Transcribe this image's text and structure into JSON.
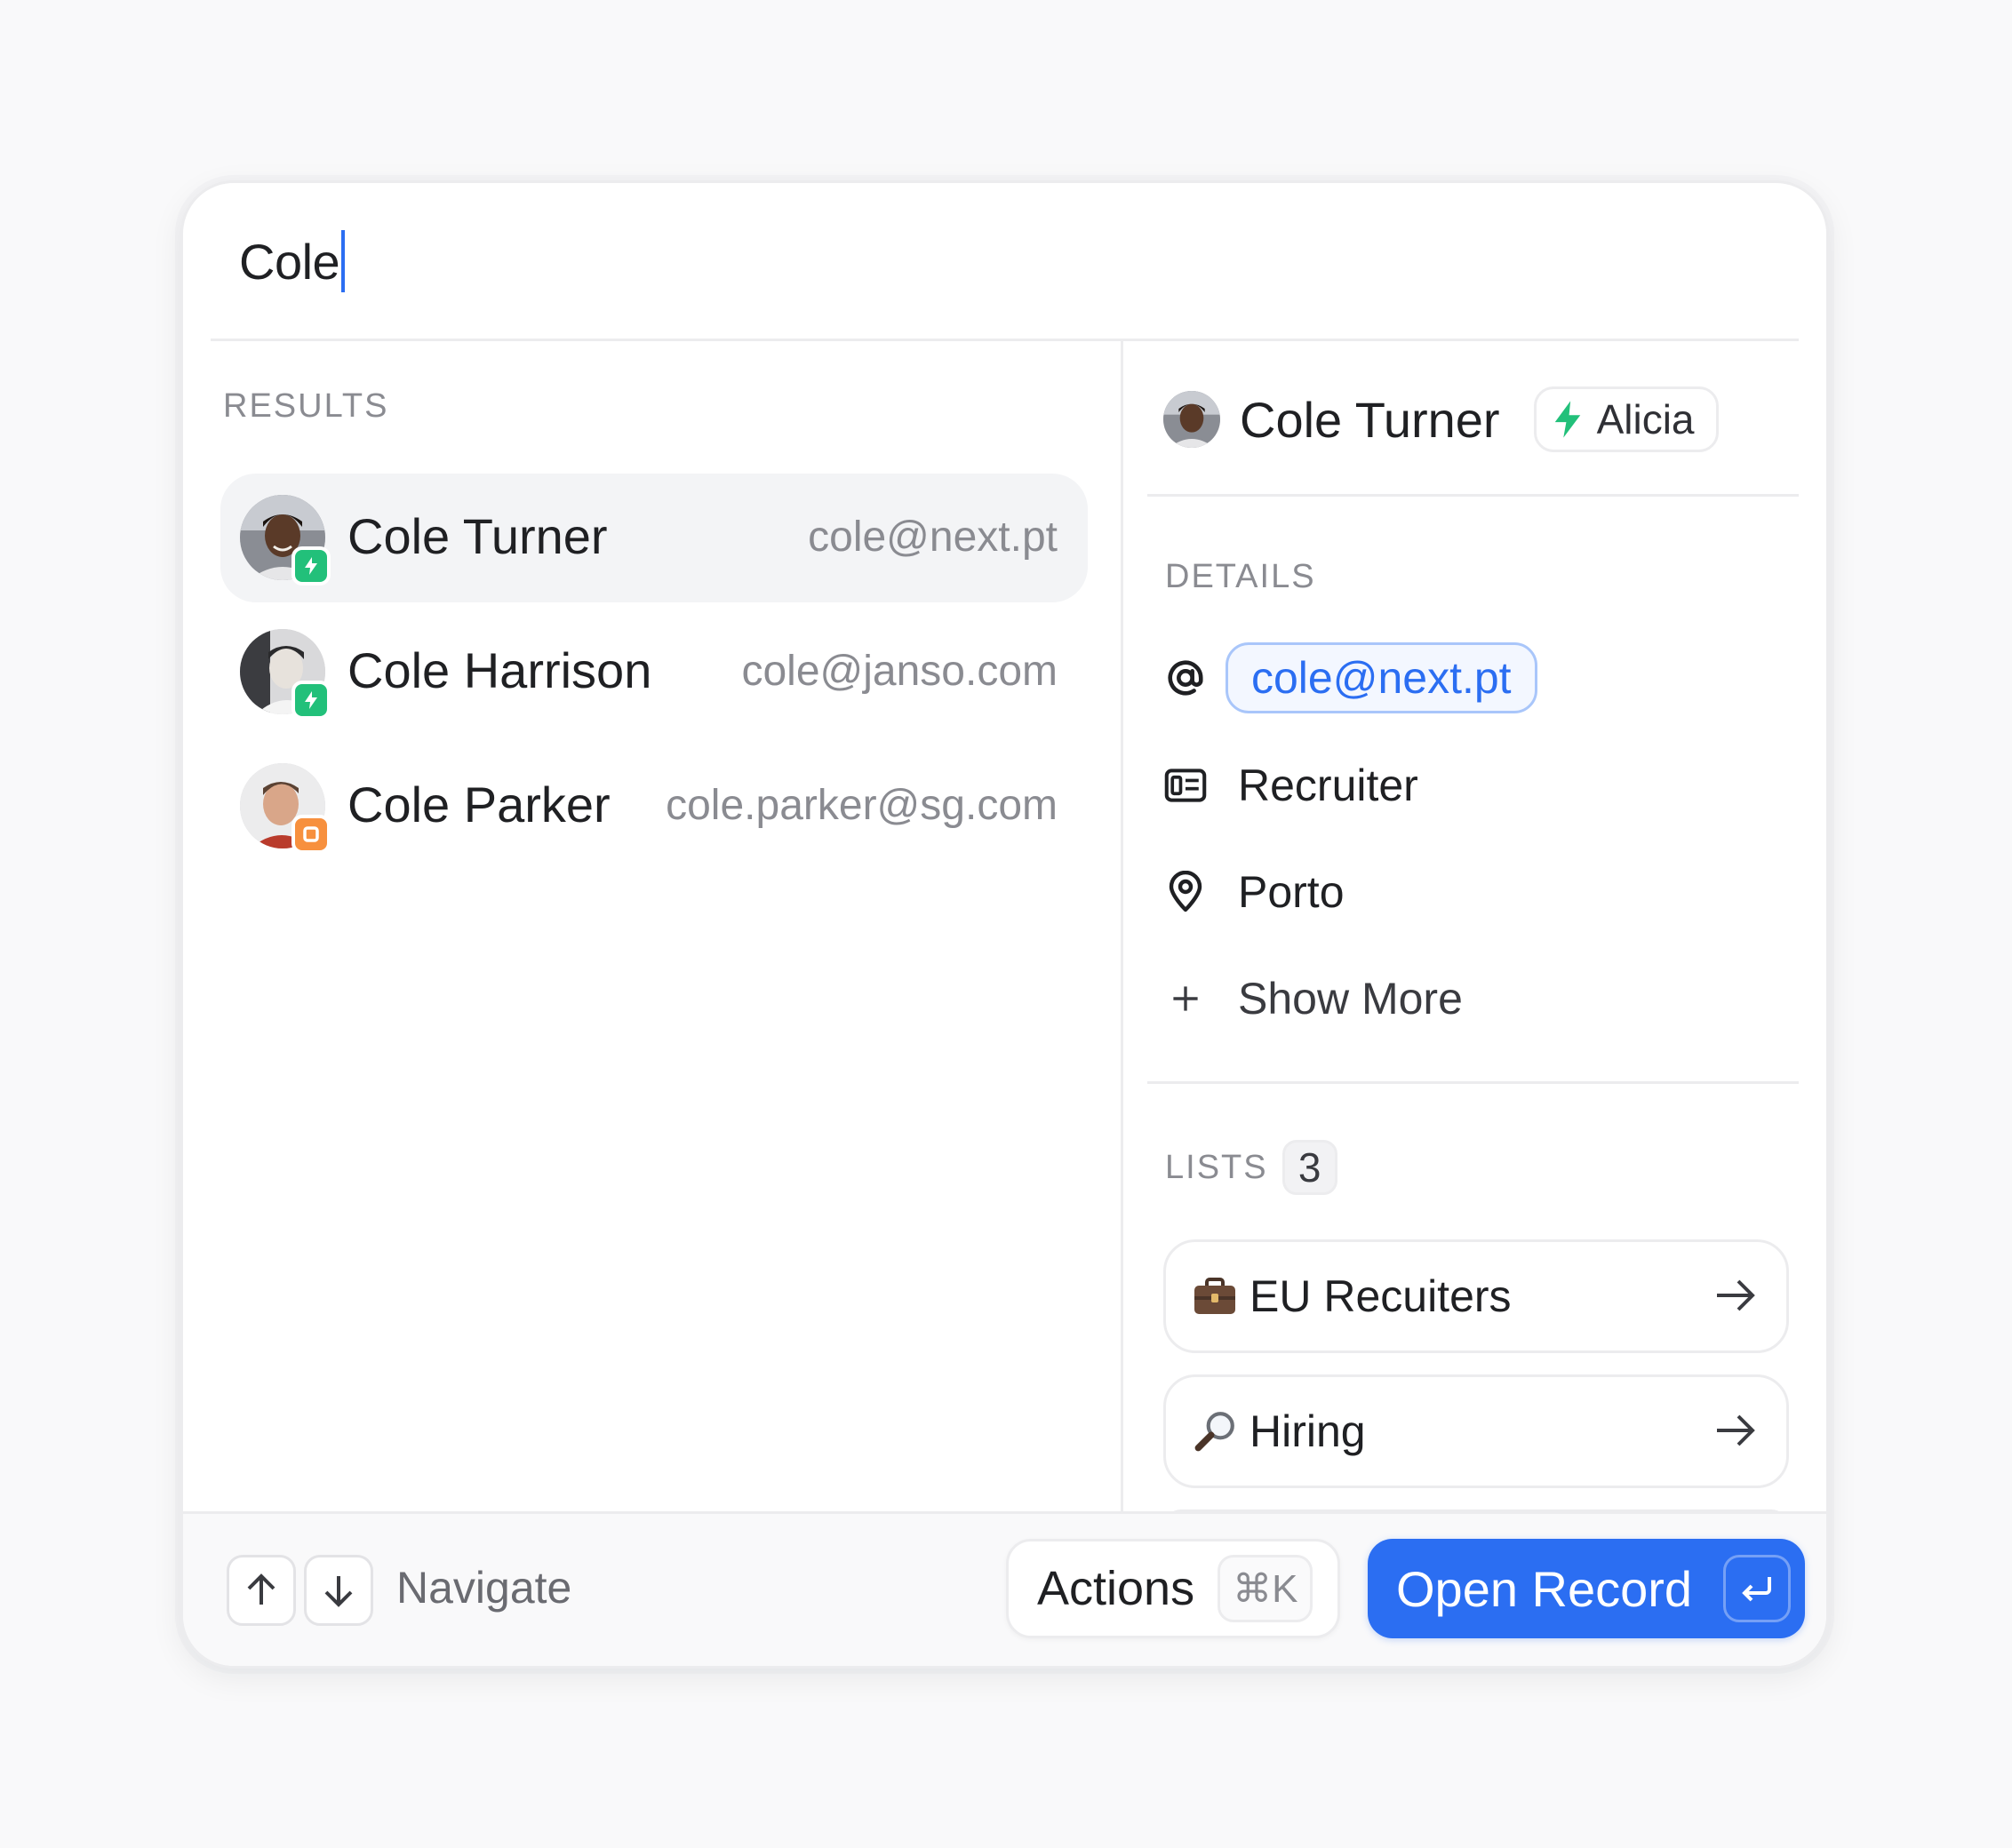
{
  "search": {
    "query": "Cole"
  },
  "results": {
    "section_label": "RESULTS",
    "items": [
      {
        "name": "Cole Turner",
        "email": "cole@next.pt",
        "badge": "bolt",
        "badge_color": "#22c07a",
        "selected": true
      },
      {
        "name": "Cole Harrison",
        "email": "cole@janso.com",
        "badge": "bolt",
        "badge_color": "#22c07a",
        "selected": false
      },
      {
        "name": "Cole Parker",
        "email": "cole.parker@sg.com",
        "badge": "square",
        "badge_color": "#f7903e",
        "selected": false
      }
    ]
  },
  "detail": {
    "name": "Cole Turner",
    "owner": "Alicia",
    "details_label": "DETAILS",
    "email": "cole@next.pt",
    "role": "Recruiter",
    "location": "Porto",
    "show_more": "Show More",
    "lists_label": "LISTS",
    "lists_count": "3",
    "lists": [
      {
        "icon": "briefcase-icon",
        "label": "EU Recuiters"
      },
      {
        "icon": "magnifier-icon",
        "label": "Hiring"
      }
    ]
  },
  "footer": {
    "navigate_label": "Navigate",
    "actions_label": "Actions",
    "actions_shortcut": "⌘K",
    "open_label": "Open Record"
  },
  "colors": {
    "accent": "#2b6ef2",
    "bolt": "#22c07a",
    "orange": "#f7903e"
  }
}
